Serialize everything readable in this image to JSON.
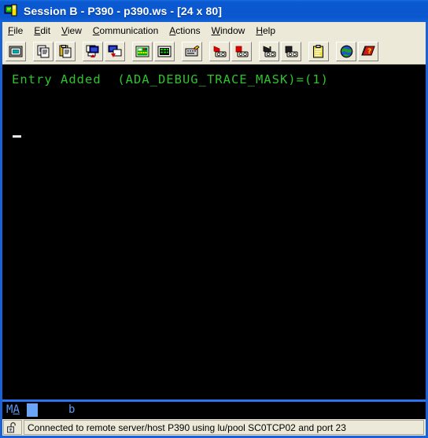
{
  "window": {
    "title": "Session B - P390 - p390.ws - [24 x 80]",
    "icon": "session-window-icon",
    "title_bar_color": "#0b57cf",
    "border_color": "#1a62d6"
  },
  "menubar": {
    "items": [
      {
        "label": "File",
        "accel": "F",
        "name": "menu-file"
      },
      {
        "label": "Edit",
        "accel": "E",
        "name": "menu-edit"
      },
      {
        "label": "View",
        "accel": "V",
        "name": "menu-view"
      },
      {
        "label": "Communication",
        "accel": "C",
        "name": "menu-communication"
      },
      {
        "label": "Actions",
        "accel": "A",
        "name": "menu-actions"
      },
      {
        "label": "Window",
        "accel": "W",
        "name": "menu-window"
      },
      {
        "label": "Help",
        "accel": "H",
        "name": "menu-help"
      }
    ]
  },
  "toolbar": {
    "buttons": [
      {
        "name": "display-screen-icon",
        "tooltip": "Display"
      },
      {
        "gap": true
      },
      {
        "name": "copy-icon",
        "tooltip": "Copy"
      },
      {
        "name": "paste-icon",
        "tooltip": "Paste"
      },
      {
        "gap": true
      },
      {
        "name": "send-file-icon",
        "tooltip": "Send File to Host"
      },
      {
        "name": "receive-file-icon",
        "tooltip": "Receive File from Host"
      },
      {
        "gap": true
      },
      {
        "name": "keypad-icon",
        "tooltip": "Keypad"
      },
      {
        "name": "calculator-icon",
        "tooltip": "Pad"
      },
      {
        "gap": true
      },
      {
        "name": "edit-keyboard-icon",
        "tooltip": "Keyboard Setup"
      },
      {
        "gap": true
      },
      {
        "name": "record-macro-icon",
        "tooltip": "Record Macro"
      },
      {
        "name": "stop-record-icon",
        "tooltip": "Stop Recording"
      },
      {
        "gap": true
      },
      {
        "name": "play-macro-icon",
        "tooltip": "Play Macro"
      },
      {
        "name": "stop-macro-icon",
        "tooltip": "Stop Macro"
      },
      {
        "gap": true
      },
      {
        "name": "clipboard-icon",
        "tooltip": "Clipboard"
      },
      {
        "gap": true
      },
      {
        "name": "globe-icon",
        "tooltip": "Internet"
      },
      {
        "name": "help-book-icon",
        "tooltip": "Help"
      }
    ]
  },
  "terminal": {
    "rows": 24,
    "cols": 80,
    "foreground_color": "#2fc22f",
    "background_color": "#000000",
    "cursor_color": "#e8e8e8",
    "lines": [
      "Entry Added  (ADA_DEBUG_TRACE_MASK)=(1)"
    ]
  },
  "oia": {
    "system_indicator": "MA",
    "system_indicator_underlined_char": "A",
    "insert_indicator": "b",
    "text_color": "#5b9bf8",
    "block_color": "#6aa6f5"
  },
  "statusbar": {
    "icon": "unlocked-padlock-icon",
    "message": "Connected to remote server/host P390 using lu/pool SC0TCP02 and port 23"
  }
}
